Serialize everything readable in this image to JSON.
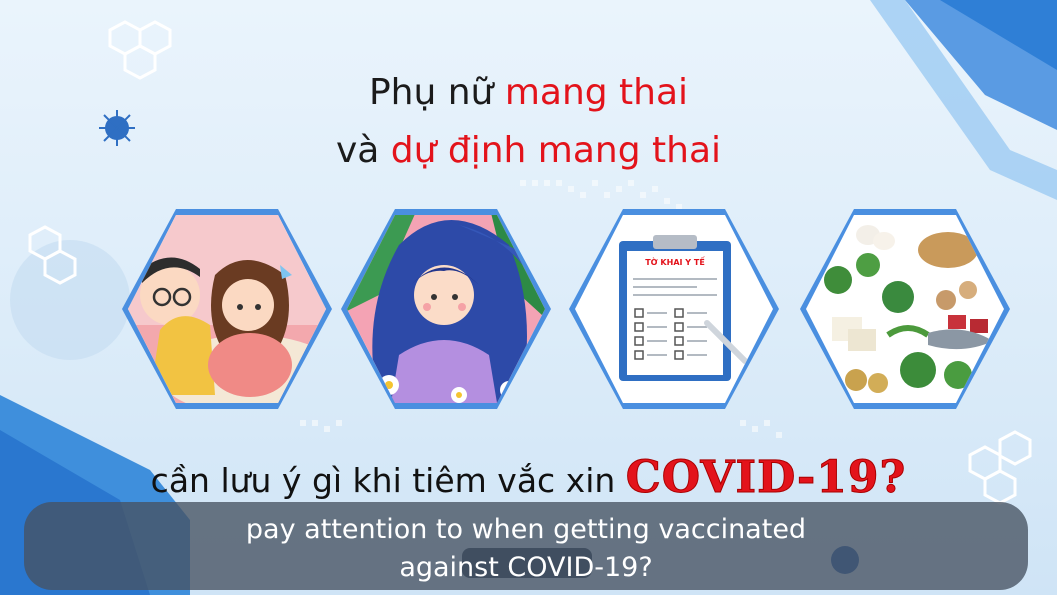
{
  "title": {
    "line1_a": "Phụ nữ ",
    "line1_b": "mang thai",
    "line2_a": "và ",
    "line2_b": "dự định mang thai",
    "accent_color": "#e3131b"
  },
  "panels": [
    {
      "name": "sleeping-couple-illustration"
    },
    {
      "name": "woman-with-flowers-illustration"
    },
    {
      "name": "medical-form-clipboard-illustration",
      "form_title": "TỜ KHAI Y TẾ"
    },
    {
      "name": "healthy-food-illustration"
    }
  ],
  "question": {
    "text": "cần lưu ý gì khi tiêm vắc xin ",
    "highlight": "COVID-19?"
  },
  "subtitle": {
    "line1": "pay attention to when getting vaccinated",
    "line2": "against COVID-19?"
  },
  "colors": {
    "brand_blue": "#3f8fdc",
    "frame_blue": "#7fb5ea",
    "text_red": "#e3131b"
  }
}
